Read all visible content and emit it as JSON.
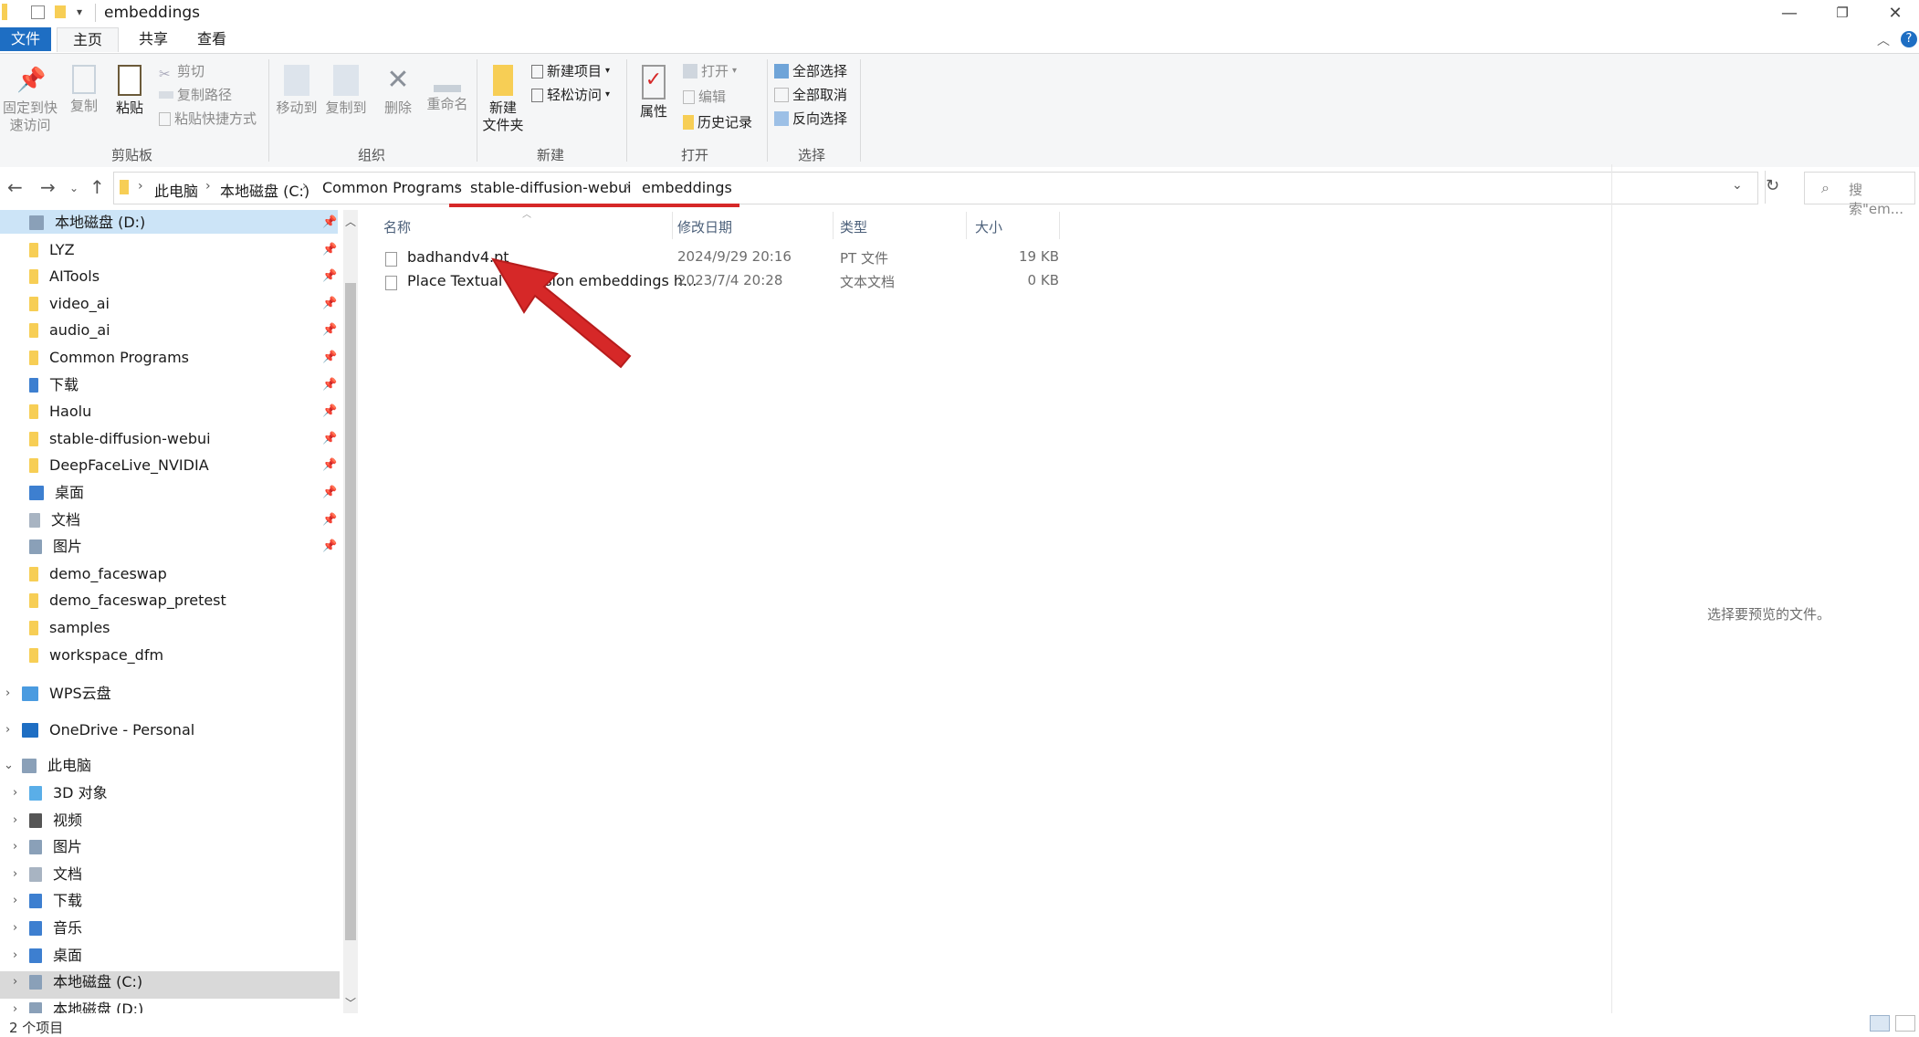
{
  "window": {
    "title": "embeddings",
    "help": "?"
  },
  "menu": {
    "tabs": [
      "文件",
      "主页",
      "共享",
      "查看"
    ]
  },
  "ribbon": {
    "clipboard": {
      "pin_label_1": "固定到快",
      "pin_label_2": "速访问",
      "copy": "复制",
      "paste": "粘贴",
      "cut": "剪切",
      "copy_path": "复制路径",
      "paste_shortcut": "粘贴快捷方式",
      "group": "剪贴板"
    },
    "organize": {
      "move_to": "移动到",
      "copy_to": "复制到",
      "delete": "删除",
      "rename": "重命名",
      "group": "组织"
    },
    "new": {
      "new_folder_1": "新建",
      "new_folder_2": "文件夹",
      "new_item": "新建项目",
      "easy_access": "轻松访问",
      "group": "新建"
    },
    "open": {
      "properties": "属性",
      "open": "打开",
      "edit": "编辑",
      "history": "历史记录",
      "group": "打开"
    },
    "select": {
      "select_all": "全部选择",
      "select_none": "全部取消",
      "invert": "反向选择",
      "group": "选择"
    }
  },
  "address": {
    "crumbs": [
      "此电脑",
      "本地磁盘 (C:)",
      "Common Programs",
      "stable-diffusion-webui",
      "embeddings"
    ],
    "search_placeholder": "搜索\"em..."
  },
  "nav": {
    "quick_access": [
      {
        "label": "本地磁盘 (D:)"
      },
      {
        "label": "LYZ"
      },
      {
        "label": "AITools"
      },
      {
        "label": "video_ai"
      },
      {
        "label": "audio_ai"
      },
      {
        "label": "Common Programs"
      },
      {
        "label": "下载"
      },
      {
        "label": "Haolu"
      },
      {
        "label": "stable-diffusion-webui"
      },
      {
        "label": "DeepFaceLive_NVIDIA"
      },
      {
        "label": "桌面"
      },
      {
        "label": "文档"
      },
      {
        "label": "图片"
      },
      {
        "label": "demo_faceswap"
      },
      {
        "label": "demo_faceswap_pretest"
      },
      {
        "label": "samples"
      },
      {
        "label": "workspace_dfm"
      }
    ],
    "wps": "WPS云盘",
    "onedrive": "OneDrive - Personal",
    "this_pc": "此电脑",
    "pc_items": [
      {
        "label": "3D 对象"
      },
      {
        "label": "视频"
      },
      {
        "label": "图片"
      },
      {
        "label": "文档"
      },
      {
        "label": "下载"
      },
      {
        "label": "音乐"
      },
      {
        "label": "桌面"
      },
      {
        "label": "本地磁盘 (C:)"
      },
      {
        "label": "本地磁盘 (D:)"
      }
    ]
  },
  "columns": {
    "name": "名称",
    "date": "修改日期",
    "type": "类型",
    "size": "大小"
  },
  "files": [
    {
      "name": "badhandv4.pt",
      "date": "2024/9/29 20:16",
      "type": "PT 文件",
      "size": "19 KB"
    },
    {
      "name": "Place Textual Inversion embeddings h...",
      "date": "2023/7/4 20:28",
      "type": "文本文档",
      "size": "0 KB"
    }
  ],
  "preview": {
    "text": "选择要预览的文件。"
  },
  "status": {
    "count": "2 个项目"
  },
  "colors": {
    "accent": "#1e6ec3",
    "annotation": "#d62828",
    "folder": "#f7ce55"
  }
}
